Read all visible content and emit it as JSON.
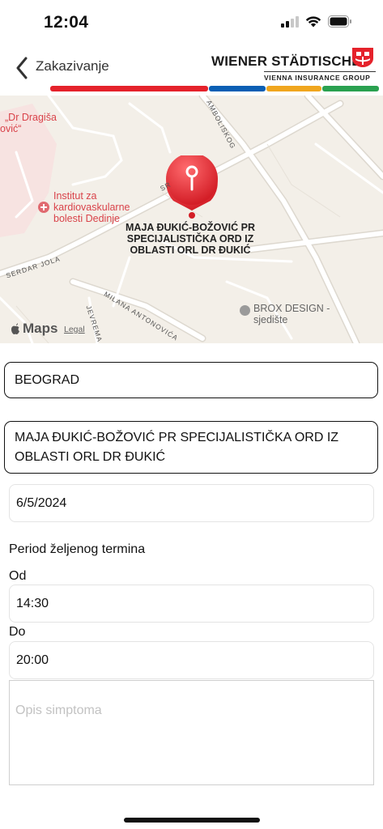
{
  "status_bar": {
    "time": "12:04"
  },
  "header": {
    "back_label": "Zakazivanje",
    "brand_name": "WIENER STÄDTISCHE",
    "brand_sub": "VIENNA INSURANCE GROUP",
    "stripe_colors": [
      "#e5222b",
      "#0a5fb4",
      "#f0a61e",
      "#2aa150"
    ]
  },
  "map": {
    "poi_1": [
      "„Dr Dragiša",
      "ović“"
    ],
    "poi_2": [
      "Institut za",
      "kardiovaskularne",
      "bolesti Dedinje"
    ],
    "pin_title": [
      "MAJA ĐUKIĆ-BOŽOVIĆ PR",
      "SPECIJALISTIČKA ORD IZ",
      "OBLASTI ORL DR ĐUKIĆ"
    ],
    "brox": [
      "BROX DESIGN -",
      "sjedište"
    ],
    "streets": {
      "simbolickog": "AMBOLISKOG",
      "serdar": "SERDAR JOLA",
      "milana": "MILANA ANTONOVIĆA",
      "jevrem": "JEVREMA",
      "sr": "SR"
    },
    "maps_label": "Maps",
    "legal": "Legal",
    "pin_color": "#e0262e"
  },
  "form": {
    "city": "BEOGRAD",
    "clinic": "MAJA ĐUKIĆ-BOŽOVIĆ PR SPECIJALISTIČKA ORD IZ OBLASTI ORL DR ĐUKIĆ",
    "date": "6/5/2024",
    "period_label": "Period željenog termina",
    "from_label": "Od",
    "from_value": "14:30",
    "to_label": "Do",
    "to_value": "20:00",
    "symptoms_placeholder": "Opis simptoma"
  }
}
